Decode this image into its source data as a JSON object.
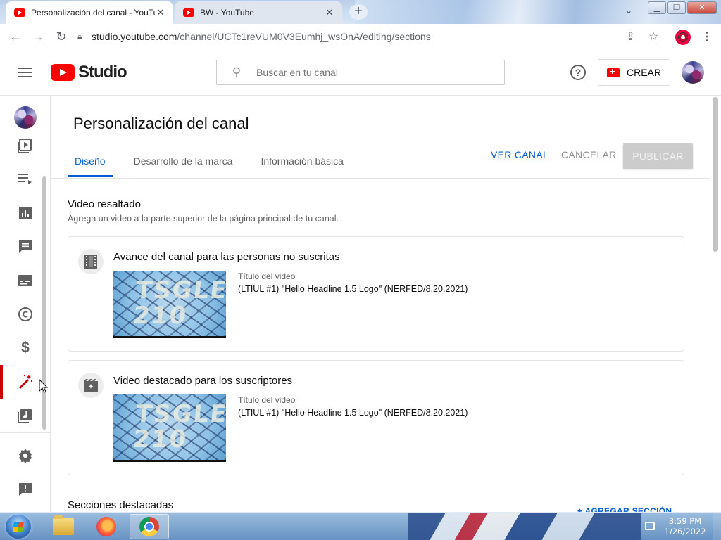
{
  "browser": {
    "tabs": [
      {
        "title": "Personalización del canal - YouTube",
        "active": true
      },
      {
        "title": "BW - YouTube",
        "active": false
      }
    ],
    "url_host": "studio.youtube.com",
    "url_path": "/channel/UCTc1reVUM0V3Eumhj_wsOnA/editing/sections"
  },
  "header": {
    "logo_text": "Studio",
    "search_placeholder": "Buscar en tu canal",
    "create_label": "CREAR"
  },
  "page": {
    "title": "Personalización del canal",
    "tabs": [
      {
        "label": "Diseño",
        "active": true
      },
      {
        "label": "Desarrollo de la marca",
        "active": false
      },
      {
        "label": "Información básica",
        "active": false
      }
    ],
    "actions": {
      "view_channel": "VER CANAL",
      "cancel": "CANCELAR",
      "publish": "PUBLICAR"
    }
  },
  "featured_video": {
    "title": "Video resaltado",
    "description": "Agrega un video a la parte superior de la página principal de tu canal.",
    "cards": [
      {
        "title": "Avance del canal para las personas no suscritas",
        "thumb_text": "TSGLE 210",
        "meta_label": "Título del video",
        "video_title": "(LTIUL #1) \"Hello Headline 1.5 Logo\" (NERFED/8.20.2021)"
      },
      {
        "title": "Video destacado para los suscriptores",
        "thumb_text": "TSGLE 210",
        "meta_label": "Título del video",
        "video_title": "(LTIUL #1) \"Hello Headline 1.5 Logo\" (NERFED/8.20.2021)"
      }
    ]
  },
  "featured_sections": {
    "title": "Secciones destacadas",
    "add_label": "+ AGREGAR SECCIÓN"
  },
  "sidebar": {
    "items": [
      {
        "icon": "content-icon"
      },
      {
        "icon": "playlists-icon"
      },
      {
        "icon": "analytics-icon"
      },
      {
        "icon": "comments-icon"
      },
      {
        "icon": "subtitles-icon"
      },
      {
        "icon": "copyright-icon"
      },
      {
        "icon": "monetization-icon"
      },
      {
        "icon": "customization-icon",
        "active": true
      },
      {
        "icon": "audio-library-icon"
      },
      {
        "icon": "settings-icon"
      },
      {
        "icon": "feedback-icon"
      }
    ]
  },
  "taskbar": {
    "time": "3:59 PM",
    "date": "1/26/2022"
  },
  "colors": {
    "accent_blue": "#065fd4",
    "brand_red": "#ff0000",
    "active_nav_red": "#cc0000"
  }
}
